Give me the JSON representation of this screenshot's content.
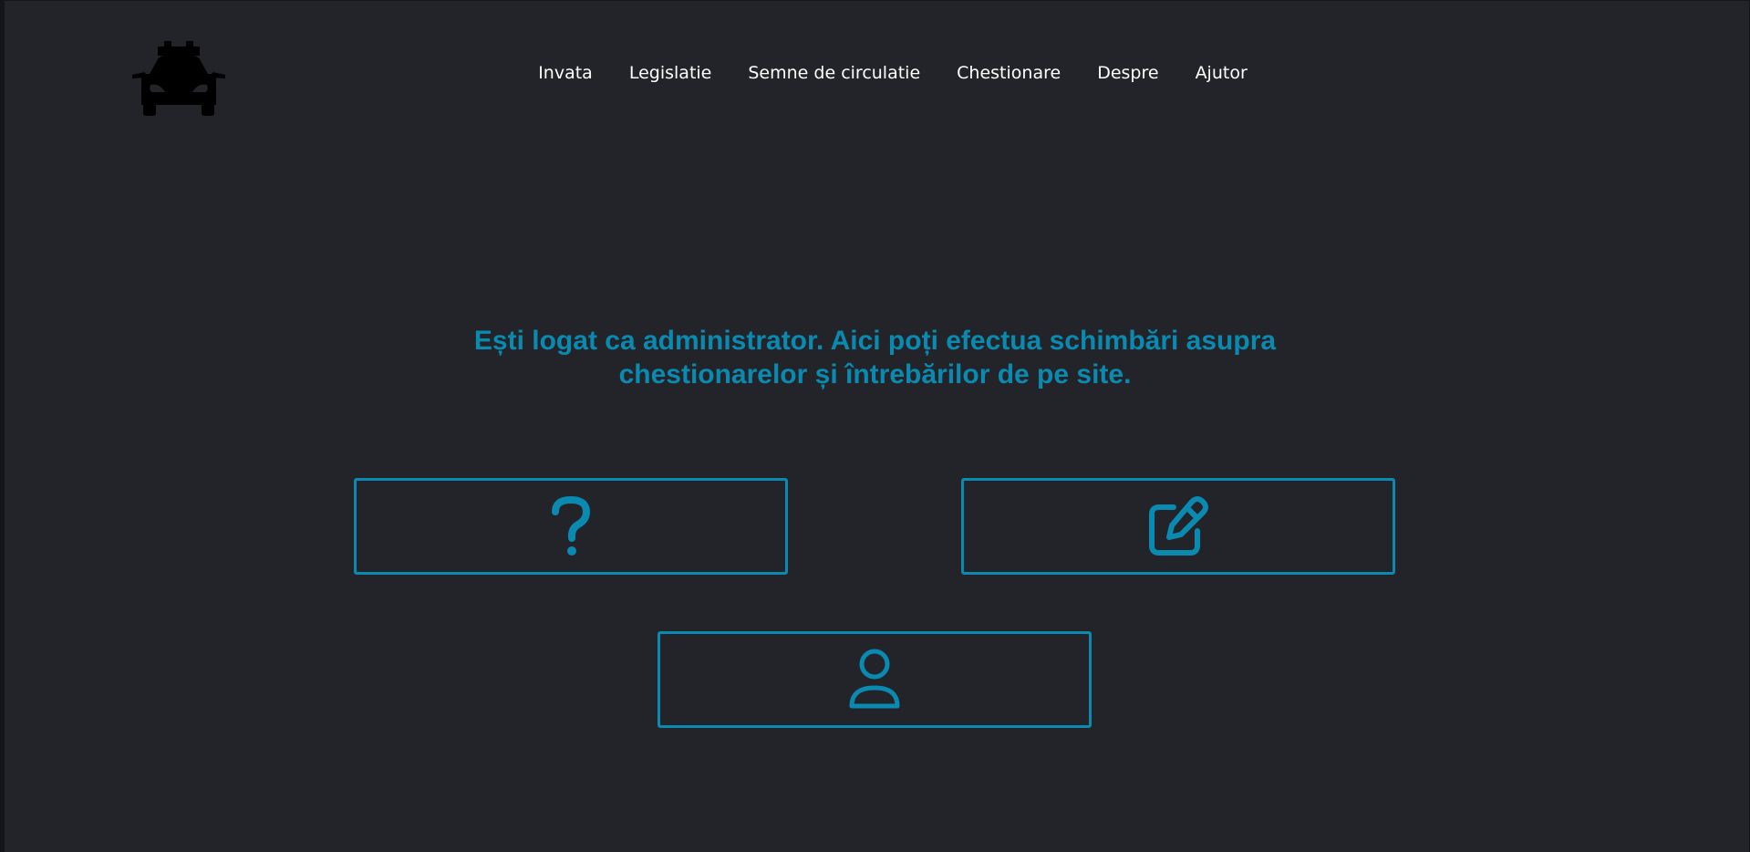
{
  "header": {
    "logo_icon": "taxi-car-icon",
    "nav": [
      {
        "label": "Invata"
      },
      {
        "label": "Legislatie"
      },
      {
        "label": "Semne de circulatie"
      },
      {
        "label": "Chestionare"
      },
      {
        "label": "Despre"
      },
      {
        "label": "Ajutor"
      }
    ]
  },
  "main": {
    "headline_line1": "Ești logat ca administrator. Aici poți efectua schimbări asupra",
    "headline_line2": "chestionarelor și întrebărilor de pe site.",
    "tiles": [
      {
        "icon": "question-mark-icon"
      },
      {
        "icon": "edit-icon"
      },
      {
        "icon": "user-icon"
      }
    ]
  },
  "colors": {
    "background": "#232429",
    "accent": "#0a8ab0",
    "nav_text": "#ffffff",
    "logo": "#000000"
  }
}
